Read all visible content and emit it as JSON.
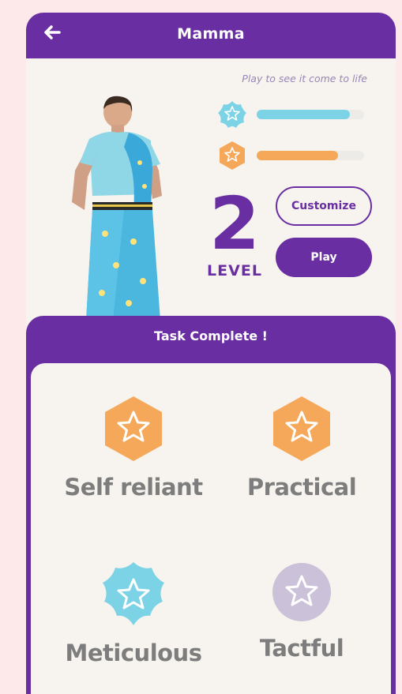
{
  "header": {
    "title": "Mamma",
    "back_icon": "arrow-left-icon"
  },
  "profile": {
    "hint": "Play to see it come to life",
    "stats": [
      {
        "icon": "cyan-star-badge-icon",
        "color": "#7dd3e6",
        "fill": 0.87
      },
      {
        "icon": "orange-star-badge-icon",
        "color": "#f5a85a",
        "fill": 0.76
      }
    ],
    "level_number": "2",
    "level_label": "LEVEL",
    "customize_label": "Customize",
    "play_label": "Play"
  },
  "task_sheet": {
    "title": "Task Complete !",
    "traits": [
      {
        "label": "Self reliant",
        "icon": "orange-hexagon-star-icon",
        "color": "#f5a85a"
      },
      {
        "label": "Practical",
        "icon": "orange-hexagon-star-icon",
        "color": "#f5a85a"
      },
      {
        "label": "Meticulous",
        "icon": "cyan-flower-star-icon",
        "color": "#7dd3e6"
      },
      {
        "label": "Tactful",
        "icon": "lavender-circle-star-icon",
        "color": "#cbc1d9"
      }
    ]
  },
  "colors": {
    "brand_purple": "#6a2ea3",
    "page_background": "#fde8ea",
    "card_background": "#f7f4ef"
  }
}
